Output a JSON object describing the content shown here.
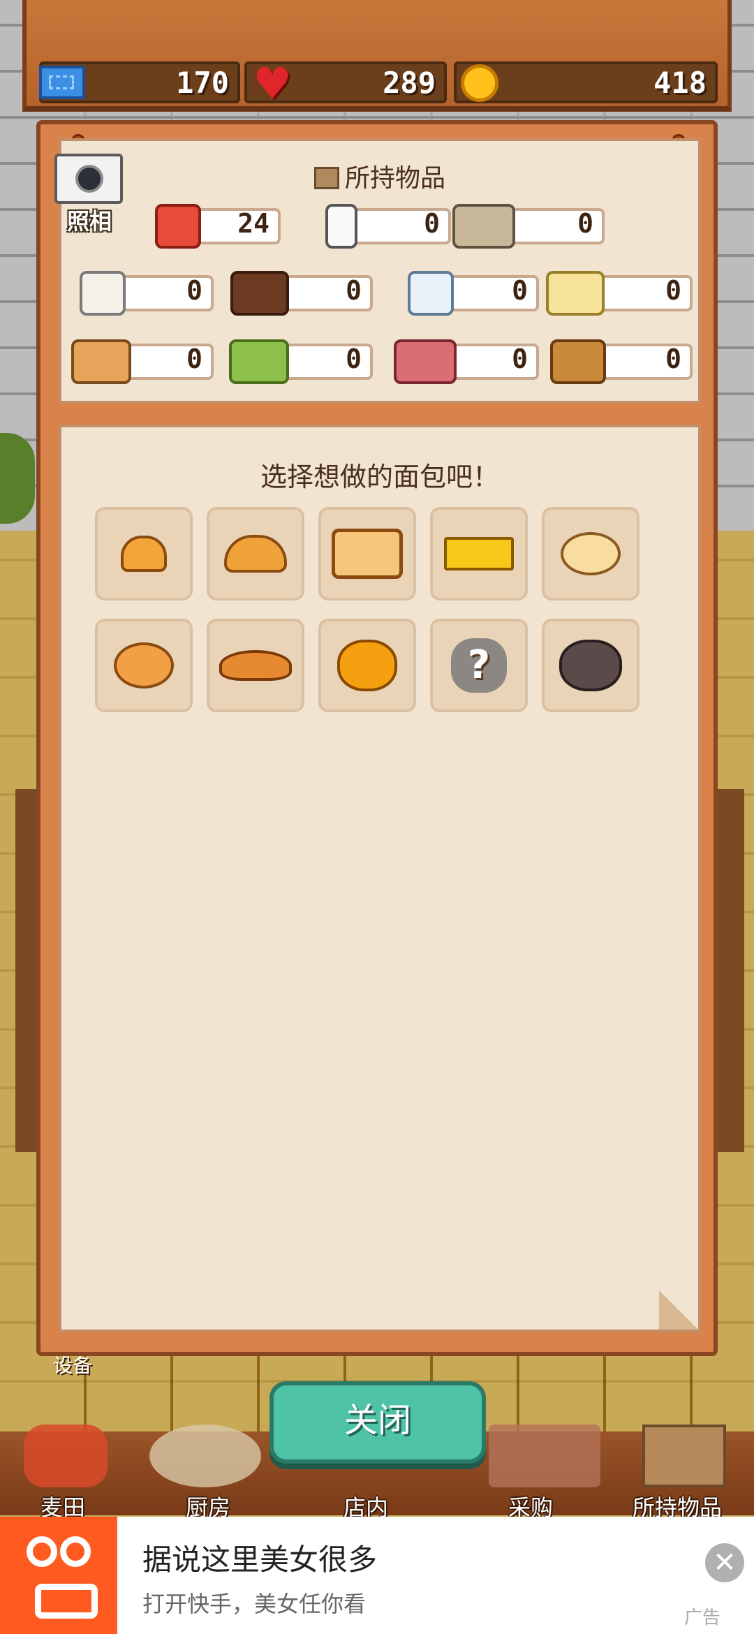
{
  "resources": {
    "tickets": "170",
    "hearts": "289",
    "coins": "418"
  },
  "camera": {
    "label": "照相"
  },
  "inventory": {
    "title": "所持物品",
    "items": [
      {
        "icon": "flour-icon",
        "count": "24"
      },
      {
        "icon": "milk-icon",
        "count": "0"
      },
      {
        "icon": "egg-sack-icon",
        "count": "0"
      },
      {
        "icon": "sugar-icon",
        "count": "0"
      },
      {
        "icon": "chocolate-icon",
        "count": "0"
      },
      {
        "icon": "cream-icon",
        "count": "0"
      },
      {
        "icon": "butter-cheese-icon",
        "count": "0"
      },
      {
        "icon": "fruit-basket-icon",
        "count": "0"
      },
      {
        "icon": "vegetable-basket-icon",
        "count": "0"
      },
      {
        "icon": "meat-icon",
        "count": "0"
      },
      {
        "icon": "spice-bottles-icon",
        "count": "0"
      }
    ]
  },
  "bread_picker": {
    "title": "选择想做的面包吧！",
    "breads": [
      "small-roll-icon",
      "bun-icon",
      "loaf-icon",
      "butter-bread-icon",
      "bagel-icon",
      "donut-icon",
      "croissant-icon",
      "pumpkin-bread-icon",
      "locked-bread-icon",
      "witch-bread-icon"
    ]
  },
  "close_button": {
    "label": "关闭"
  },
  "partial_label": "设备",
  "nav": {
    "items": [
      {
        "label": "麦田",
        "icon": "wheat-field-icon"
      },
      {
        "label": "厨房",
        "icon": "kitchen-icon"
      },
      {
        "label": "店内",
        "icon": "store-icon"
      },
      {
        "label": "采购",
        "icon": "shopping-icon"
      },
      {
        "label": "所持物品",
        "icon": "inventory-box-icon"
      }
    ]
  },
  "ad": {
    "title": "据说这里美女很多",
    "subtitle": "打开快手，美女任你看",
    "tag": "广告"
  },
  "colors": {
    "panel": "#d9824a",
    "paper": "#f1e4d1",
    "close_button": "#4fc3a8",
    "ad_brand": "#ff5a1f"
  }
}
